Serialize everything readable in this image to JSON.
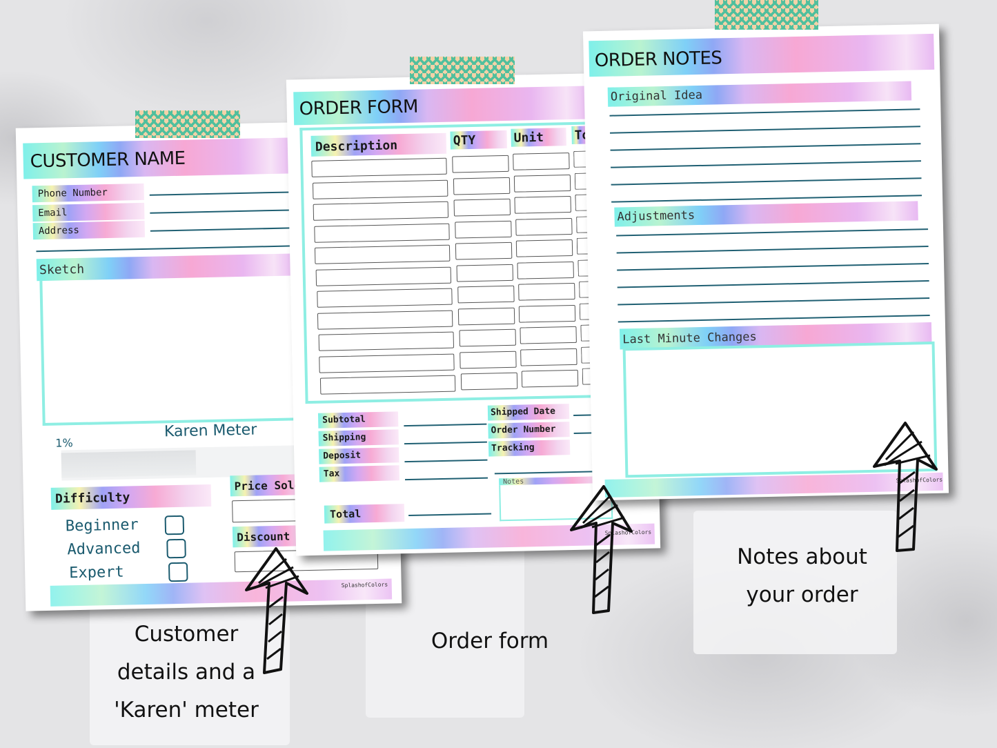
{
  "customer_page": {
    "title": "CUSTOMER NAME",
    "fields": [
      "Phone Number",
      "Email",
      "Address"
    ],
    "sketch_label": "Sketch",
    "karen_meter": {
      "title": "Karen Meter",
      "value_label": "1%",
      "fill_fraction": 0.01
    },
    "difficulty": {
      "title": "Difficulty",
      "options": [
        "Beginner",
        "Advanced",
        "Expert"
      ]
    },
    "price_sold_label": "Price Sold",
    "discount_label": "Discount",
    "credit": "SplashofColors"
  },
  "order_form_page": {
    "title": "ORDER FORM",
    "columns": [
      "Description",
      "QTY",
      "Unit",
      "To"
    ],
    "row_count": 11,
    "totals": [
      "Subtotal",
      "Shipping",
      "Deposit",
      "Tax"
    ],
    "total_label": "Total",
    "shipping_fields": [
      "Shipped Date",
      "Order Number",
      "Tracking"
    ],
    "notes_label": "Notes",
    "credit": "SplashofColors"
  },
  "order_notes_page": {
    "title": "ORDER NOTES",
    "sections": [
      "Original Idea",
      "Adjustments",
      "Last Minute Changes"
    ],
    "credit": "SplashofColors"
  },
  "captions": {
    "customer": [
      "Customer",
      "details and a",
      "'Karen' meter"
    ],
    "order_form": "Order form",
    "notes": [
      "Notes about",
      "your order"
    ]
  },
  "colors": {
    "teal_border": "#8eeee3",
    "line": "#1f5f72",
    "tape_green": "#4fbf9d",
    "tape_tan": "#f3d2a8",
    "label_teal": "#1a5a6e"
  }
}
